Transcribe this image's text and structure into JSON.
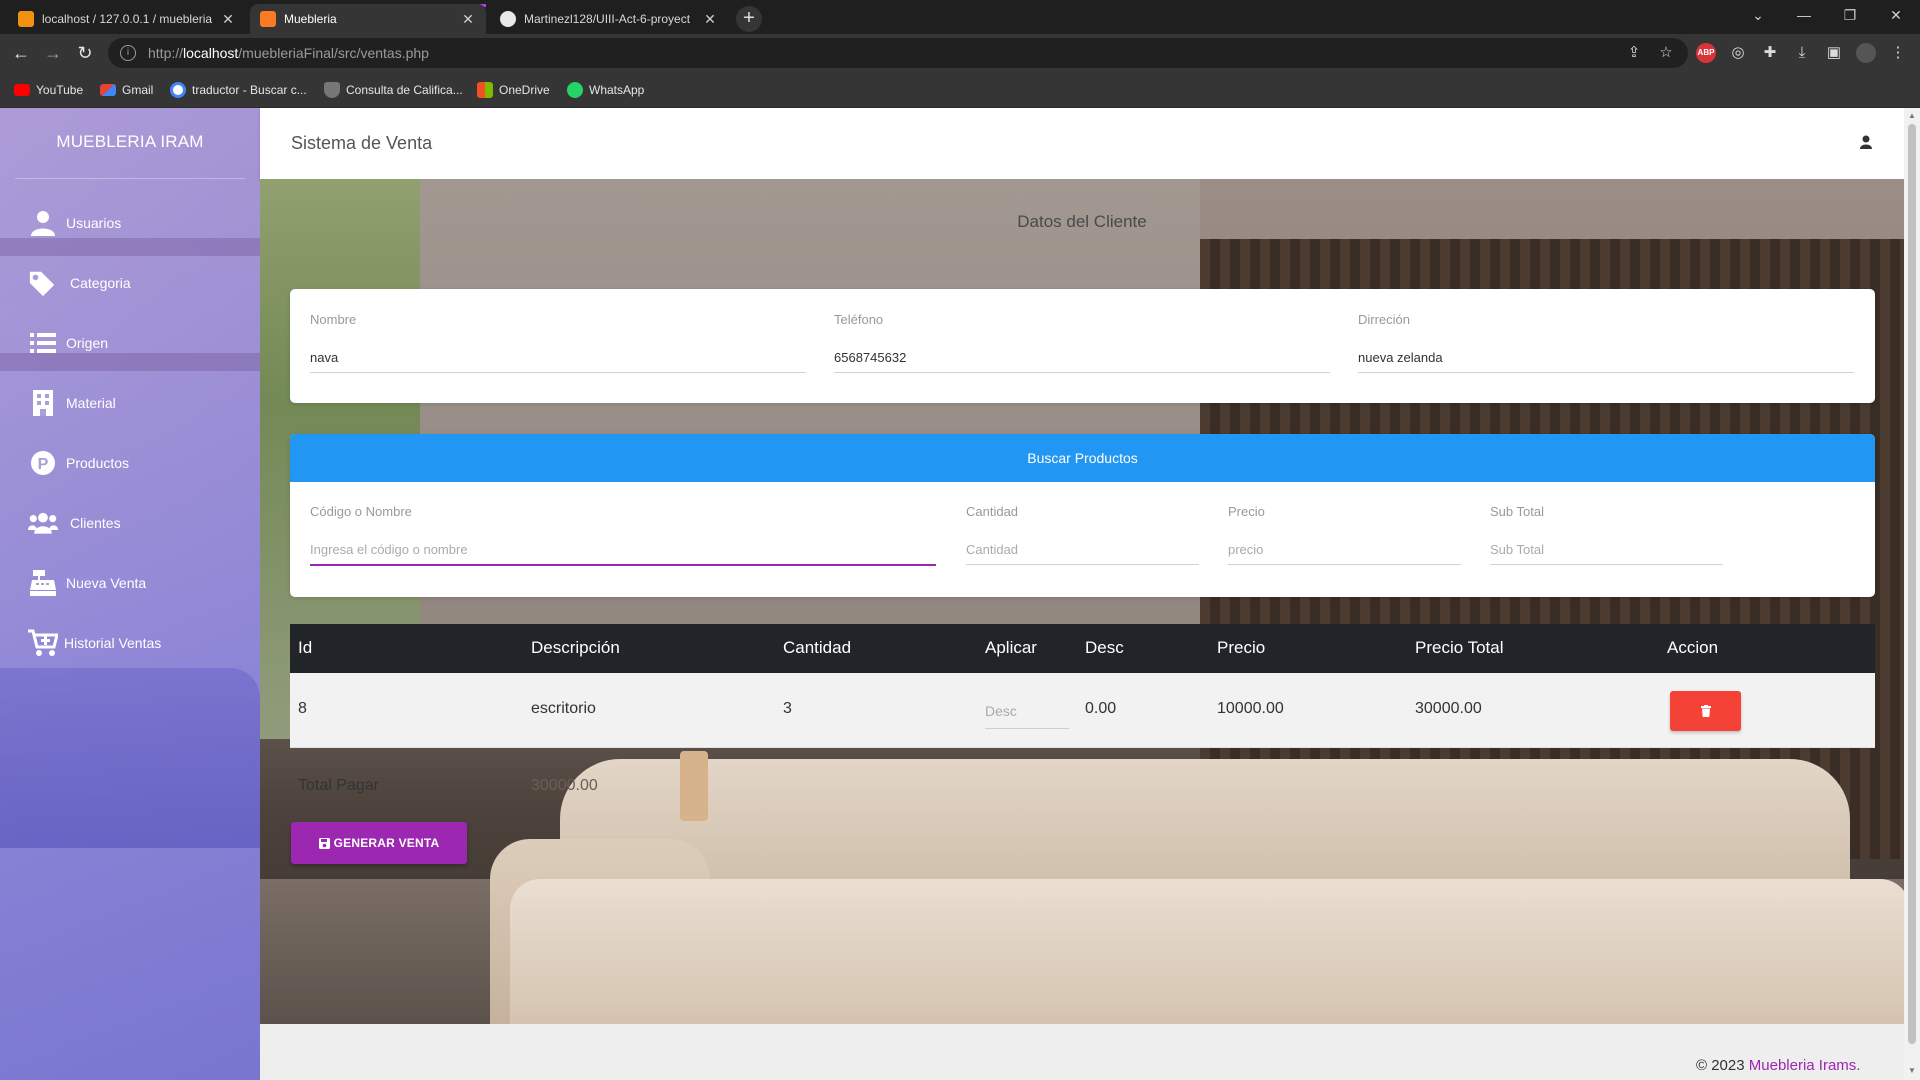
{
  "browser": {
    "tabs": [
      {
        "title": "localhost / 127.0.0.1 / muebleria",
        "icon": "phpmyadmin-icon"
      },
      {
        "title": "Muebleria",
        "icon": "xampp-icon"
      },
      {
        "title": "Martinezl128/UIII-Act-6-proyect",
        "icon": "github-icon"
      }
    ],
    "url_prefix": "http://",
    "url_host": "localhost",
    "url_path": "/muebleriaFinal/src/ventas.php",
    "bookmarks": [
      {
        "label": "YouTube",
        "icon": "youtube-icon"
      },
      {
        "label": "Gmail",
        "icon": "gmail-icon"
      },
      {
        "label": "traductor - Buscar c...",
        "icon": "google-icon"
      },
      {
        "label": "Consulta de Califica...",
        "icon": "shield-icon"
      },
      {
        "label": "OneDrive",
        "icon": "onedrive-icon"
      },
      {
        "label": "WhatsApp",
        "icon": "whatsapp-icon"
      }
    ]
  },
  "sidebar": {
    "brand": "MUEBLERIA IRAM",
    "items": [
      {
        "label": "Usuarios",
        "icon": "user-icon"
      },
      {
        "label": "Categoria",
        "icon": "tags-icon"
      },
      {
        "label": "Origen",
        "icon": "list-icon"
      },
      {
        "label": "Material",
        "icon": "building-icon"
      },
      {
        "label": "Productos",
        "icon": "product-icon"
      },
      {
        "label": "Clientes",
        "icon": "users-icon"
      },
      {
        "label": "Nueva Venta",
        "icon": "cash-register-icon"
      },
      {
        "label": "Historial Ventas",
        "icon": "cart-plus-icon"
      }
    ]
  },
  "navbar": {
    "title": "Sistema de Venta",
    "user_icon": "user-icon"
  },
  "client": {
    "section_title": "Datos del Cliente",
    "nombre_label": "Nombre",
    "nombre_value": "nava",
    "telefono_label": "Teléfono",
    "telefono_value": "6568745632",
    "direccion_label": "Dirreción",
    "direccion_value": "nueva zelanda"
  },
  "search": {
    "header": "Buscar Productos",
    "codigo_label": "Código o Nombre",
    "codigo_placeholder": "Ingresa el código o nombre",
    "cantidad_label": "Cantidad",
    "cantidad_placeholder": "Cantidad",
    "precio_label": "Precio",
    "precio_placeholder": "precio",
    "subtotal_label": "Sub Total",
    "subtotal_placeholder": "Sub Total"
  },
  "table": {
    "headers": [
      "Id",
      "Descripción",
      "Cantidad",
      "Aplicar",
      "Desc",
      "Precio",
      "Precio Total",
      "Accion"
    ],
    "rows": [
      {
        "id": "8",
        "descripcion": "escritorio",
        "cantidad": "3",
        "aplicar_placeholder": "Desc",
        "desc": "0.00",
        "precio": "10000.00",
        "precio_total": "30000.00",
        "action_icon": "trash-icon"
      }
    ]
  },
  "totals": {
    "label": "Total Pagar",
    "value": "30000.00"
  },
  "actions": {
    "generate_label": "GENERAR VENTA",
    "generate_icon": "save-icon"
  },
  "footer": {
    "copyright": "© 2023",
    "link": "Muebleria Irams."
  },
  "colors": {
    "primary_purple": "#9c27b0",
    "info_blue": "#2196f3",
    "danger_red": "#f44336",
    "table_dark": "#212529"
  }
}
